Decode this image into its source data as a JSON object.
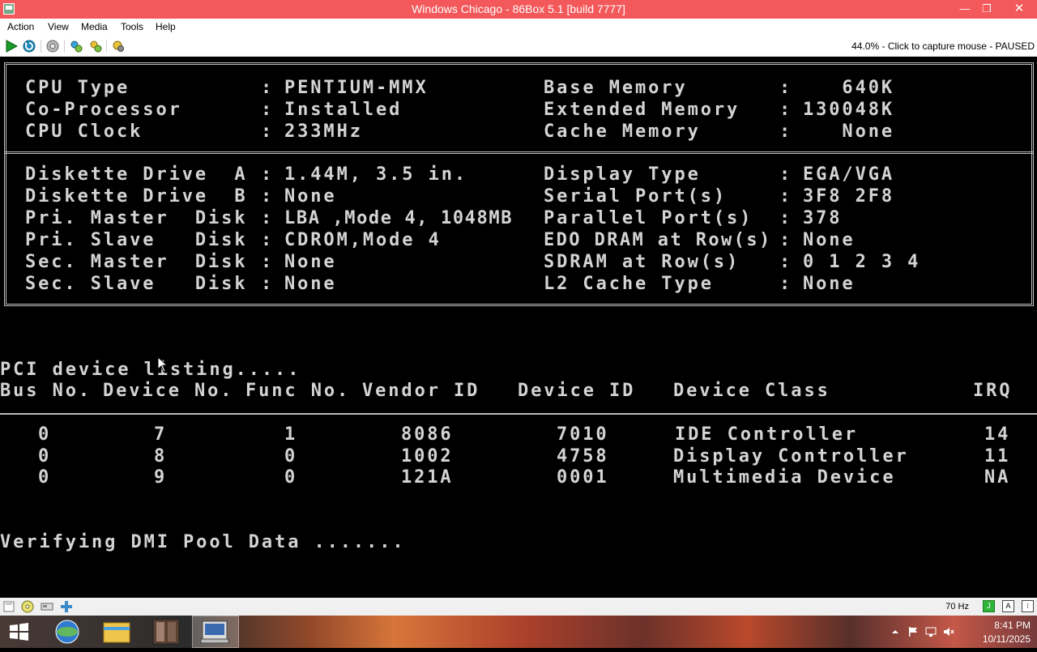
{
  "window": {
    "title": "Windows Chicago - 86Box 5.1 [build 7777]",
    "min_glyph": "—",
    "max_glyph": "❐",
    "close_glyph": "✕"
  },
  "menu": {
    "items": [
      "Action",
      "View",
      "Media",
      "Tools",
      "Help"
    ]
  },
  "toolbar": {
    "status_message": "44.0% - Click to capture mouse - PAUSED",
    "icons": [
      "play-icon",
      "reset-icon",
      "ctrl-alt-del-icon",
      "settings-icon",
      "settings-icon",
      "settings-icon"
    ]
  },
  "bios": {
    "top_left": [
      {
        "label": "CPU Type",
        "value": "PENTIUM-MMX"
      },
      {
        "label": "Co-Processor",
        "value": "Installed"
      },
      {
        "label": "CPU Clock",
        "value": "233MHz"
      }
    ],
    "top_right": [
      {
        "label": "Base Memory",
        "value": "   640K"
      },
      {
        "label": "Extended Memory",
        "value": "130048K"
      },
      {
        "label": "Cache Memory",
        "value": "   None"
      }
    ],
    "bottom_left": [
      {
        "label": "Diskette Drive  A",
        "value": "1.44M, 3.5 in."
      },
      {
        "label": "Diskette Drive  B",
        "value": "None"
      },
      {
        "label": "Pri. Master  Disk",
        "value": "LBA ,Mode 4, 1048MB"
      },
      {
        "label": "Pri. Slave   Disk",
        "value": "CDROM,Mode 4"
      },
      {
        "label": "Sec. Master  Disk",
        "value": "None"
      },
      {
        "label": "Sec. Slave   Disk",
        "value": "None"
      }
    ],
    "bottom_right": [
      {
        "label": "Display Type",
        "value": "EGA/VGA"
      },
      {
        "label": "Serial Port(s)",
        "value": "3F8 2F8"
      },
      {
        "label": "Parallel Port(s)",
        "value": "378"
      },
      {
        "label": "EDO DRAM at Row(s)",
        "value": "None"
      },
      {
        "label": "SDRAM at Row(s)",
        "value": "0 1 2 3 4"
      },
      {
        "label": "L2 Cache Type",
        "value": "None"
      }
    ]
  },
  "pci": {
    "title": "PCI device listing.....",
    "headers": [
      "Bus No.",
      "Device No.",
      "Func No.",
      "Vendor ID",
      "Device ID",
      "Device Class",
      "IRQ"
    ],
    "rows": [
      {
        "bus": "0",
        "device": "7",
        "func": "1",
        "vendor": "8086",
        "device_id": "7010",
        "class": "IDE Controller",
        "irq": "14"
      },
      {
        "bus": "0",
        "device": "8",
        "func": "0",
        "vendor": "1002",
        "device_id": "4758",
        "class": "Display Controller",
        "irq": "11"
      },
      {
        "bus": "0",
        "device": "9",
        "func": "0",
        "vendor": "121A",
        "device_id": "0001",
        "class": "Multimedia Device",
        "irq": "NA"
      }
    ]
  },
  "boot_message": "Verifying DMI Pool Data .......",
  "statusbar": {
    "refresh_rate": "70 Hz",
    "icons": [
      "floppy-icon",
      "cdrom-icon",
      "hdd-icon",
      "network-icon"
    ],
    "right_badges": [
      "J",
      "A",
      "⁝"
    ]
  },
  "taskbar": {
    "clock_time": "8:41 PM",
    "clock_date": "10/11/2025"
  }
}
